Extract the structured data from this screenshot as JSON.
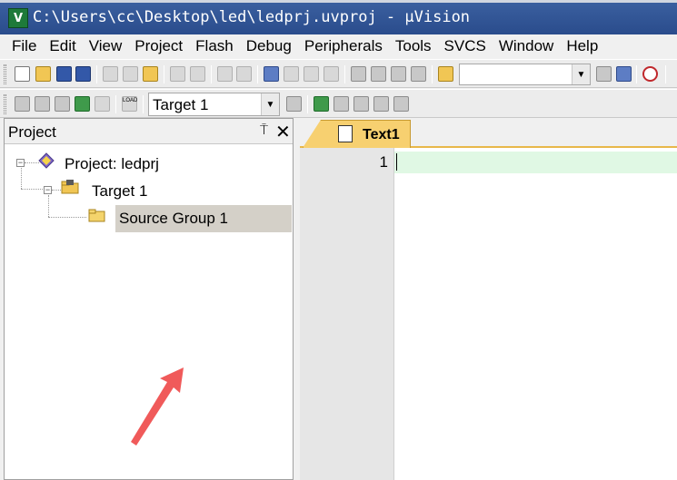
{
  "window": {
    "title": "C:\\Users\\cc\\Desktop\\led\\ledprj.uvproj - μVision",
    "icon_label": "V"
  },
  "menu": [
    "File",
    "Edit",
    "View",
    "Project",
    "Flash",
    "Debug",
    "Peripherals",
    "Tools",
    "SVCS",
    "Window",
    "Help"
  ],
  "toolbar2": {
    "target_select": "Target 1",
    "load_label": "LOAD"
  },
  "project_panel": {
    "title": "Project",
    "pin_glyph": "⍑",
    "close_glyph": "✕",
    "tree": {
      "root": "Project: ledprj",
      "target": "Target 1",
      "group": "Source Group 1"
    }
  },
  "editor": {
    "tab_label": "Text1",
    "line_numbers": [
      "1"
    ]
  },
  "colors": {
    "titlebar": "#2a4c8c",
    "tab_active": "#f7d070",
    "current_line": "#e0f8e4",
    "selection": "#d4d0c8",
    "annotation_arrow": "#f05a5a"
  }
}
